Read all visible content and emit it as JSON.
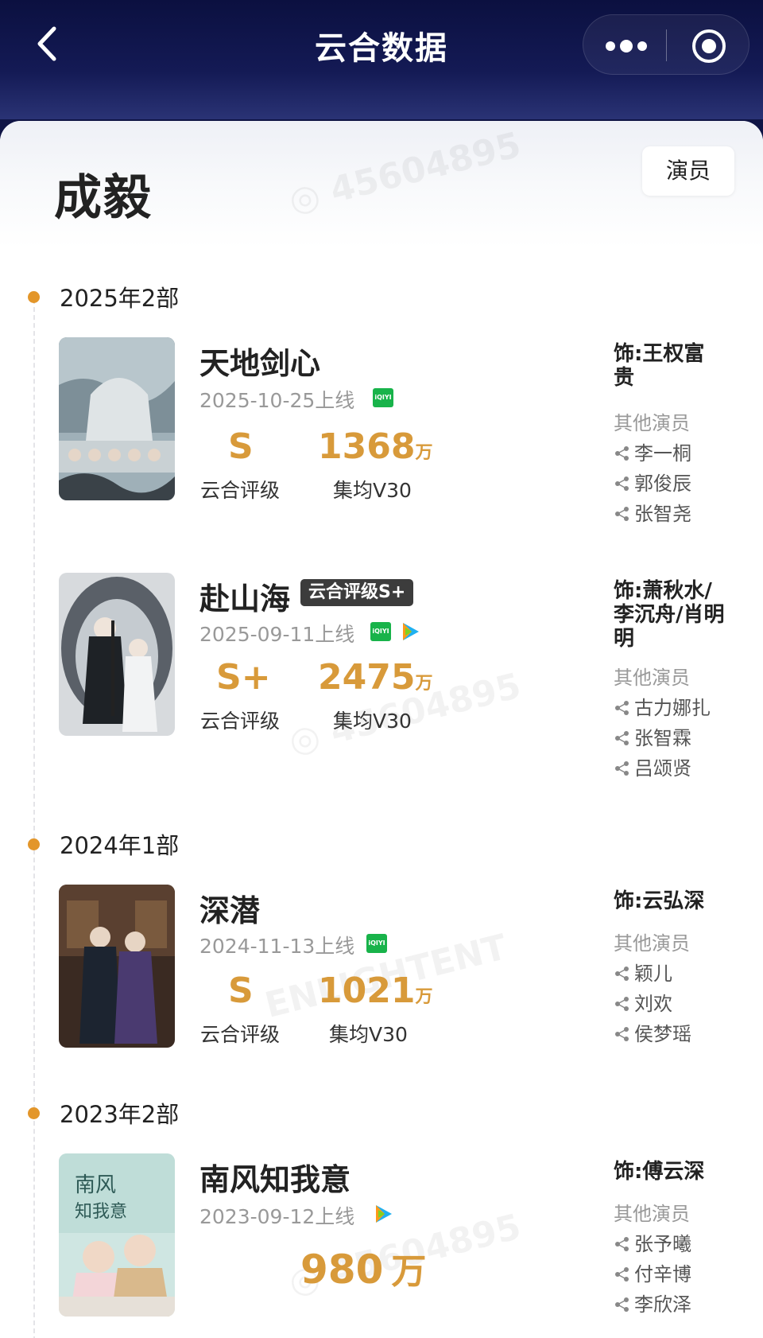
{
  "header": {
    "title": "云合数据",
    "back_icon": "chevron-left-icon",
    "more_icon": "more-dots-icon",
    "close_icon": "target-close-icon"
  },
  "profile": {
    "name": "成毅",
    "role_tag": "演员"
  },
  "groups": [
    {
      "year_label": "2025年2部",
      "dramas": [
        {
          "title": "天地剑心",
          "release": "2025-10-25上线",
          "platforms": [
            "iqiyi"
          ],
          "grade": "S",
          "grade_label": "云合评级",
          "views": "1368",
          "views_unit": "万",
          "views_label": "集均V30",
          "role": "饰:王权富贵",
          "others_label": "其他演员",
          "actors": [
            "李一桐",
            "郭俊辰",
            "张智尧"
          ]
        },
        {
          "title": "赴山海",
          "badge": "云合评级S+",
          "release": "2025-09-11上线",
          "platforms": [
            "iqiyi",
            "tencent"
          ],
          "grade": "S+",
          "grade_label": "云合评级",
          "views": "2475",
          "views_unit": "万",
          "views_label": "集均V30",
          "role": "饰:萧秋水/李沉舟/肖明明",
          "others_label": "其他演员",
          "actors": [
            "古力娜扎",
            "张智霖",
            "吕颂贤"
          ]
        }
      ]
    },
    {
      "year_label": "2024年1部",
      "dramas": [
        {
          "title": "深潜",
          "release": "2024-11-13上线",
          "platforms": [
            "iqiyi"
          ],
          "grade": "S",
          "grade_label": "云合评级",
          "views": "1021",
          "views_unit": "万",
          "views_label": "集均V30",
          "role": "饰:云弘深",
          "others_label": "其他演员",
          "actors": [
            "颖儿",
            "刘欢",
            "侯梦瑶"
          ]
        }
      ]
    },
    {
      "year_label": "2023年2部",
      "dramas": [
        {
          "title": "南风知我意",
          "release": "2023-09-12上线",
          "platforms": [
            "tencent"
          ],
          "views": "980",
          "views_unit": "万",
          "role": "饰:傅云深",
          "others_label": "其他演员",
          "actors": [
            "张予曦",
            "付辛博",
            "李欣泽"
          ]
        }
      ]
    }
  ],
  "platform_labels": {
    "iqiyi": "iQIYI"
  },
  "colors": {
    "accent": "#d89a3a",
    "timeline_dot": "#e3962a",
    "header_bg": "#0f1445",
    "iqiyi_green": "#18b34a"
  }
}
